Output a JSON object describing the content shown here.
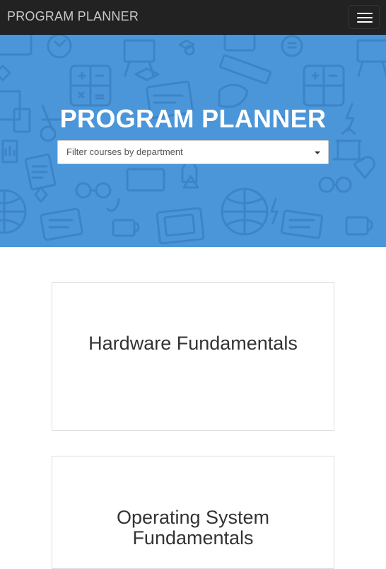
{
  "navbar": {
    "brand": "PROGRAM PLANNER",
    "menu_icon": "hamburger-menu-icon"
  },
  "hero": {
    "title": "PROGRAM PLANNER",
    "background_color": "#4a96d9",
    "filter": {
      "placeholder": "Filter courses by department",
      "icon": "caret-down-icon"
    }
  },
  "courses": [
    {
      "title": "Hardware Fundamentals"
    },
    {
      "title": "Operating System Fundamentals"
    }
  ],
  "colors": {
    "navbar_bg": "#222222",
    "hero_bg": "#4a96d9",
    "card_border": "#dddddd",
    "text_dark": "#333333"
  }
}
